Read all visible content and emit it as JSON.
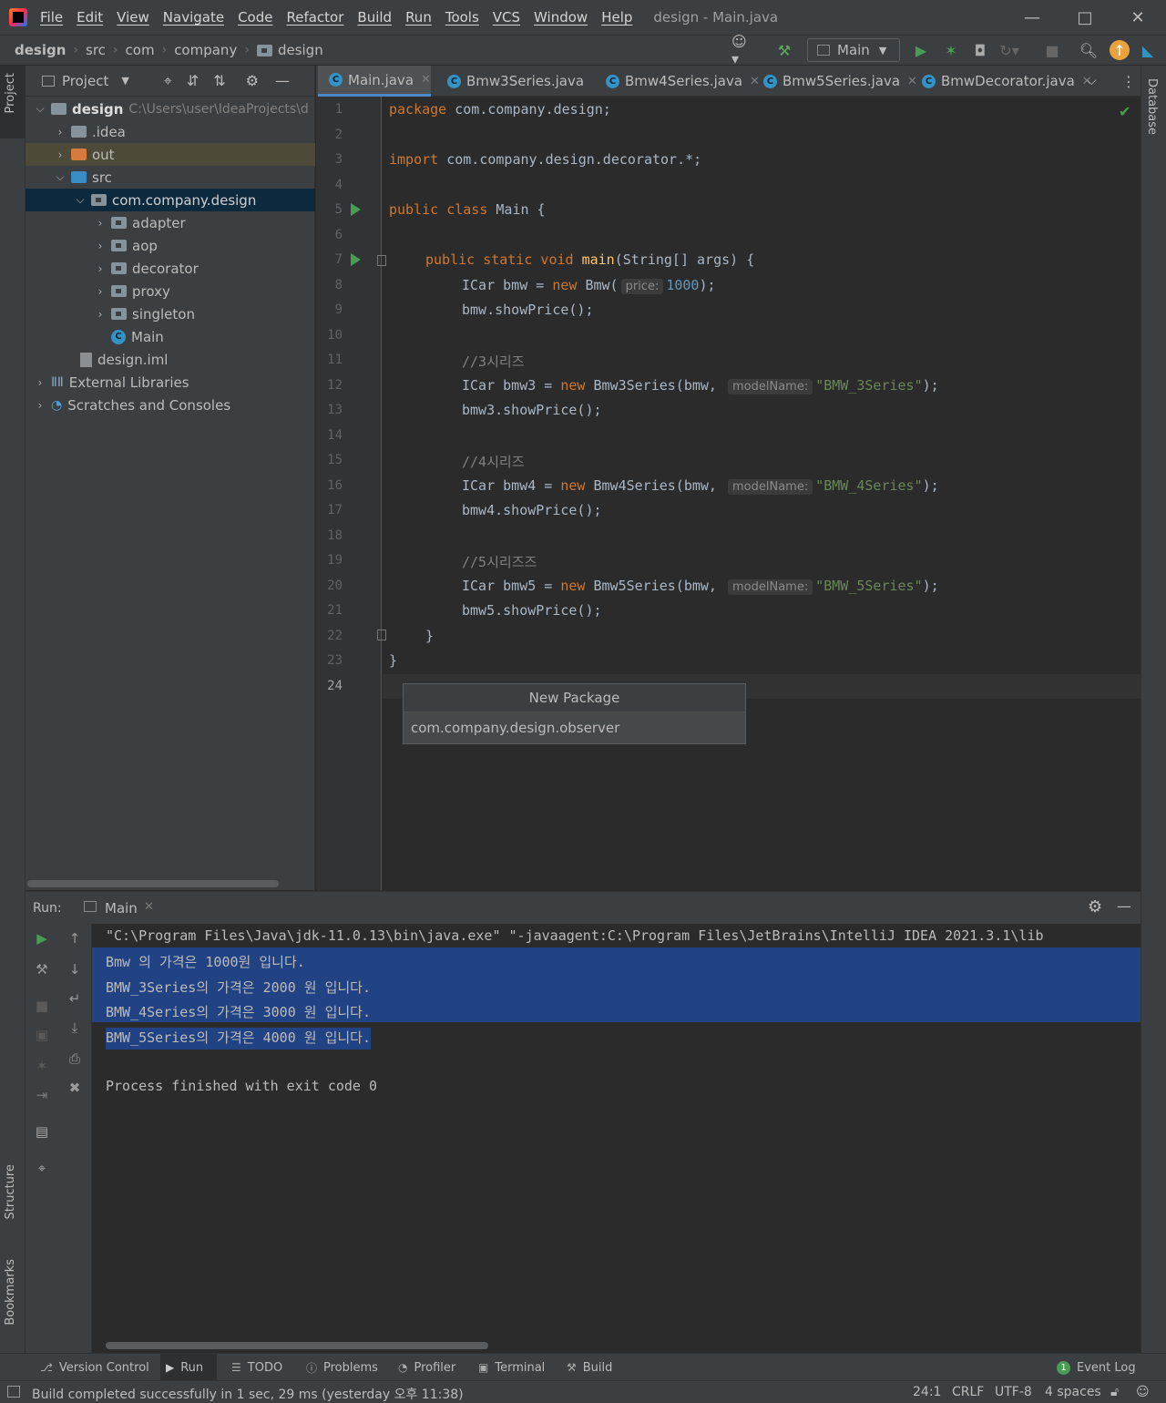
{
  "menu": {
    "items": [
      "File",
      "Edit",
      "View",
      "Navigate",
      "Code",
      "Refactor",
      "Build",
      "Run",
      "Tools",
      "VCS",
      "Window",
      "Help"
    ],
    "window_title": "design - Main.java"
  },
  "breadcrumb": [
    "design",
    "src",
    "com",
    "company",
    "design"
  ],
  "toolbar": {
    "run_config": "Main"
  },
  "left_strip": {
    "project": "Project",
    "structure": "Structure",
    "bookmarks": "Bookmarks"
  },
  "right_strip": {
    "database": "Database"
  },
  "project": {
    "header": "Project",
    "root_name": "design",
    "root_path": "C:\\Users\\user\\IdeaProjects\\d",
    "items": [
      ".idea",
      "out",
      "src",
      "com.company.design",
      "adapter",
      "aop",
      "decorator",
      "proxy",
      "singleton",
      "Main",
      "design.iml",
      "External Libraries",
      "Scratches and Consoles"
    ]
  },
  "tabs": [
    "Main.java",
    "Bmw3Series.java",
    "Bmw4Series.java",
    "Bmw5Series.java",
    "BmwDecorator.java"
  ],
  "editor": {
    "line_numbers": [
      "1",
      "2",
      "3",
      "4",
      "5",
      "6",
      "7",
      "8",
      "9",
      "10",
      "11",
      "12",
      "13",
      "14",
      "15",
      "16",
      "17",
      "18",
      "19",
      "20",
      "21",
      "22",
      "23",
      "24"
    ],
    "pkg_kw": "package",
    "pkg_name": " com.company.design;",
    "import_kw": "import",
    "import_name": " com.company.design.decorator.*;",
    "class_kw": "public class",
    "class_name": " Main {",
    "main_kw": "public static void",
    "main_name": "main",
    "main_args": "(String[] args) {",
    "l8_a": "ICar bmw = ",
    "l8_new": "new",
    "l8_b": " Bmw(",
    "l8_hint": "price:",
    "l8_num": "1000",
    "l8_c": ");",
    "l9": "bmw.showPrice();",
    "l11": "//3시리즈",
    "l12_a": "ICar bmw3 = ",
    "l12_new": "new",
    "l12_b": " Bmw3Series(bmw, ",
    "l12_hint": "modelName:",
    "l12_str": "\"BMW_3Series\"",
    "l12_c": ");",
    "l13": "bmw3.showPrice();",
    "l15": "//4시리즈",
    "l16_a": "ICar bmw4 = ",
    "l16_new": "new",
    "l16_b": " Bmw4Series(bmw, ",
    "l16_hint": "modelName:",
    "l16_str": "\"BMW_4Series\"",
    "l16_c": ");",
    "l17": "bmw4.showPrice();",
    "l19": "//5시리즈즈",
    "l20_a": "ICar bmw5 = ",
    "l20_new": "new",
    "l20_b": " Bmw5Series(bmw, ",
    "l20_hint": "modelName:",
    "l20_str": "\"BMW_5Series\"",
    "l20_c": ");",
    "l21": "bmw5.showPrice();",
    "l22": "}",
    "l23": "}"
  },
  "popup": {
    "title": "New Package",
    "value": "com.company.design.observer"
  },
  "run": {
    "label": "Run:",
    "tab": "Main",
    "lines": [
      "\"C:\\Program Files\\Java\\jdk-11.0.13\\bin\\java.exe\" \"-javaagent:C:\\Program Files\\JetBrains\\IntelliJ IDEA 2021.3.1\\lib",
      "Bmw 의 가격은 1000원 입니다.",
      "BMW_3Series의 가격은 2000 원 입니다.",
      "BMW_4Series의 가격은 3000 원 입니다.",
      "BMW_5Series의 가격은 4000 원 입니다.",
      "Process finished with exit code 0"
    ]
  },
  "bottom_tools": [
    "Version Control",
    "Run",
    "TODO",
    "Problems",
    "Profiler",
    "Terminal",
    "Build",
    "Event Log"
  ],
  "event_log_count": "1",
  "status": {
    "message": "Build completed successfully in 1 sec, 29 ms (yesterday 오후 11:38)",
    "position": "24:1",
    "line_sep": "CRLF",
    "encoding": "UTF-8",
    "indent": "4 spaces"
  },
  "colors": {
    "accent": "#4a88c7",
    "selection": "#214283",
    "run_green": "#499c54"
  }
}
